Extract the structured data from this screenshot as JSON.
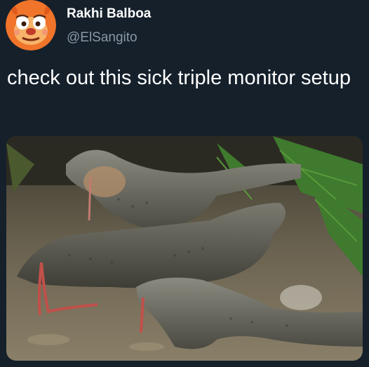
{
  "tweet": {
    "author": {
      "display_name": "Rakhi Balboa",
      "handle": "@ElSangito",
      "avatar_icon": "cartoon-character-avatar-icon"
    },
    "text": "check out this sick triple monitor setup",
    "media": {
      "description_icon": "monitor-lizards-photo"
    }
  },
  "colors": {
    "background": "#15202b",
    "primary_text": "#ffffff",
    "secondary_text": "#8899a6",
    "avatar_bg": "#f0742a"
  }
}
